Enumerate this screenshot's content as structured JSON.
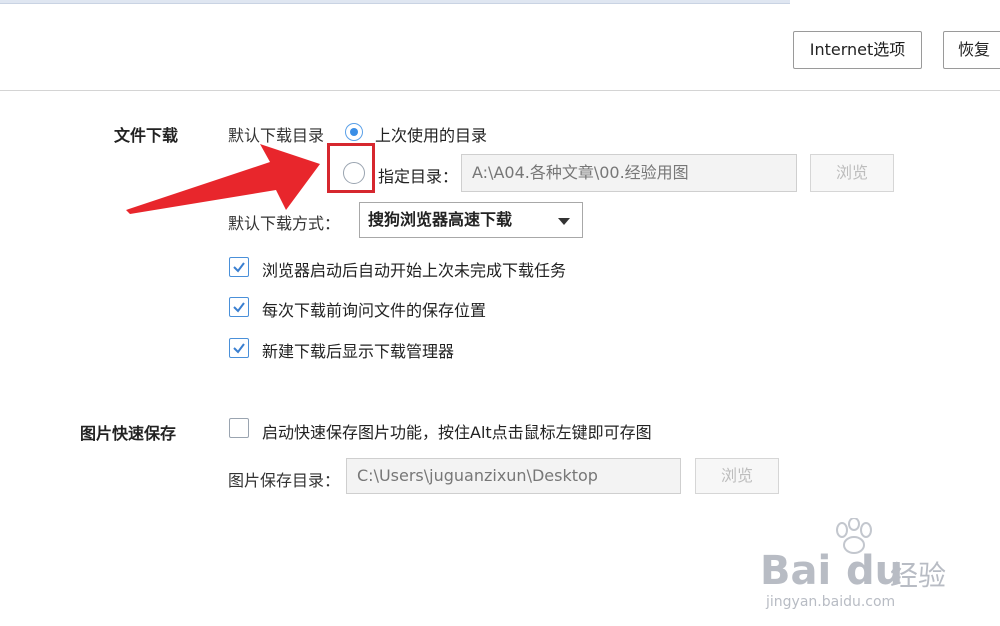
{
  "header": {
    "internet_options_label": "Internet选项",
    "restore_label": "恢复"
  },
  "download": {
    "section_title": "文件下载",
    "default_dir_label": "默认下载目录",
    "option_last_used": "上次使用的目录",
    "option_specified": "指定目录：",
    "specified_dir_value": "A:\\A04.各种文章\\00.经验用图",
    "browse_label": "浏览",
    "method_label": "默认下载方式：",
    "method_value": "搜狗浏览器高速下载",
    "checkbox_resume": "浏览器启动后自动开始上次未完成下载任务",
    "checkbox_ask_location": "每次下载前询问文件的保存位置",
    "checkbox_show_manager": "新建下载后显示下载管理器"
  },
  "image_save": {
    "section_title": "图片快速保存",
    "enable_label": "启动快速保存图片功能，按住Alt点击鼠标左键即可存图",
    "dir_label": "图片保存目录：",
    "dir_value": "C:\\Users\\juguanzixun\\Desktop",
    "browse_label": "浏览"
  },
  "watermark": {
    "brand": "Bai",
    "brand_cn": "经验",
    "url": "jingyan.baidu.com"
  },
  "state": {
    "last_used_selected": true,
    "specified_selected": false,
    "resume_checked": true,
    "ask_location_checked": true,
    "show_manager_checked": true,
    "quick_save_checked": false
  },
  "colors": {
    "accent": "#3a8ee6",
    "annotation_red": "#d6272e"
  }
}
